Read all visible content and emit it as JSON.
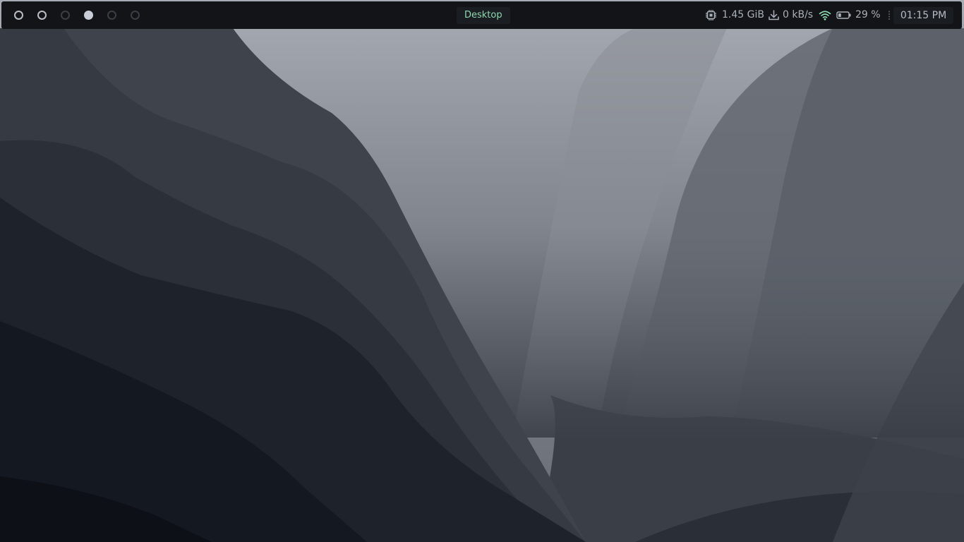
{
  "workspaces": [
    {
      "state": "occupied"
    },
    {
      "state": "occupied"
    },
    {
      "state": "empty"
    },
    {
      "state": "active"
    },
    {
      "state": "empty"
    },
    {
      "state": "empty"
    }
  ],
  "window_title": "Desktop",
  "status": {
    "memory": {
      "icon": "cpu-icon",
      "value": "1.45 GiB"
    },
    "network": {
      "icon": "download-icon",
      "value": "0 kB/s"
    },
    "wifi": {
      "icon": "wifi-icon"
    },
    "battery": {
      "icon": "battery-icon",
      "value": "29 %",
      "level": 0.29
    },
    "clock": "01:15 PM"
  },
  "colors": {
    "bar_bg": "#121418",
    "title_accent": "#8fd9b0",
    "wifi_accent": "#8fd9b0",
    "text": "#aab0b8"
  }
}
